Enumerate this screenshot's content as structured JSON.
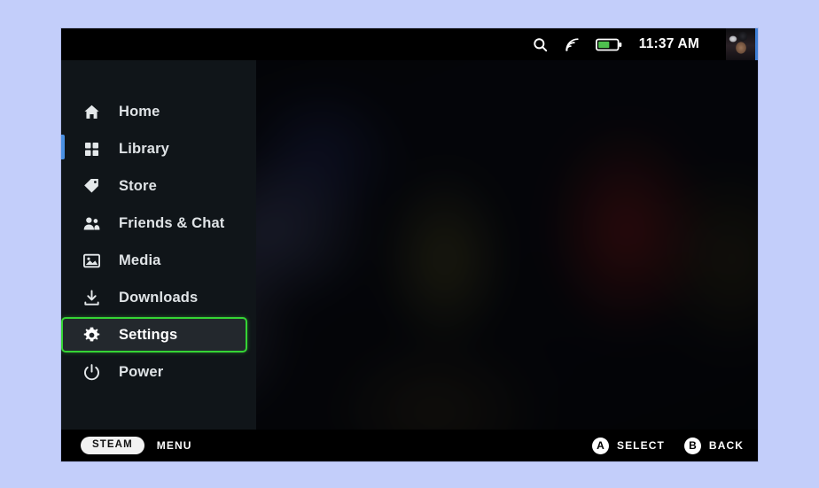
{
  "device": {
    "screen_background_color": "#000000",
    "page_background_color": "#c3cefa",
    "highlight_color": "#35d435",
    "accent_color": "#4a90e2"
  },
  "status_bar": {
    "search_icon": "search-icon",
    "wifi_icon": "wifi-icon",
    "battery_icon": "battery-icon",
    "battery_level_percent": 55,
    "battery_color": "#4fc04f",
    "time": "11:37 AM",
    "avatar": "user-avatar"
  },
  "sidebar": {
    "items": [
      {
        "label": "Home",
        "icon": "home-icon",
        "selected": false
      },
      {
        "label": "Library",
        "icon": "grid-icon",
        "selected": false
      },
      {
        "label": "Store",
        "icon": "tag-icon",
        "selected": false
      },
      {
        "label": "Friends & Chat",
        "icon": "people-icon",
        "selected": false
      },
      {
        "label": "Media",
        "icon": "image-icon",
        "selected": false
      },
      {
        "label": "Downloads",
        "icon": "download-icon",
        "selected": false
      },
      {
        "label": "Settings",
        "icon": "gear-icon",
        "selected": true
      },
      {
        "label": "Power",
        "icon": "power-icon",
        "selected": false
      }
    ]
  },
  "bottom_bar": {
    "steam_pill_label": "STEAM",
    "menu_label": "MENU",
    "select_button_glyph": "A",
    "select_label": "SELECT",
    "back_button_glyph": "B",
    "back_label": "BACK"
  }
}
